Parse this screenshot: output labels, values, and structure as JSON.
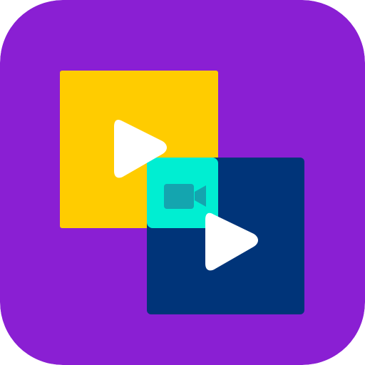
{
  "icon": {
    "name": "video-merge-app-icon",
    "colors": {
      "background": "#8A1FD3",
      "front_square": "#FFCC00",
      "back_square": "#003479",
      "overlap": "#00EED2",
      "camera": "#14A5AF",
      "play": "#FFFFFF"
    },
    "glyphs": [
      "play-icon",
      "play-icon",
      "video-camera-icon"
    ]
  }
}
